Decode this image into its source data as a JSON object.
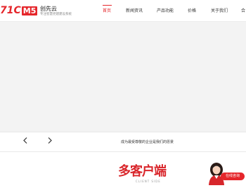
{
  "header": {
    "logo_text": "71CMS",
    "brand_name": "创先云",
    "brand_sub": "专注智慧党建建设系统",
    "nav": [
      {
        "label": "首页",
        "active": true
      },
      {
        "label": "新闻资讯"
      },
      {
        "label": "产品功能"
      },
      {
        "label": "价格"
      },
      {
        "label": "关于我们"
      },
      {
        "label": "合"
      }
    ]
  },
  "strip": {
    "prev_icon": "chevron-left",
    "next_icon": "chevron-right",
    "text": "成为最受尊敬的企业是我们的愿景"
  },
  "section": {
    "title": "多客户端",
    "subtitle": "CLIENT SIDE"
  },
  "consult": {
    "label": "在线咨询"
  },
  "colors": {
    "accent": "#e5262b",
    "banner_bg": "#f3f3f3"
  }
}
